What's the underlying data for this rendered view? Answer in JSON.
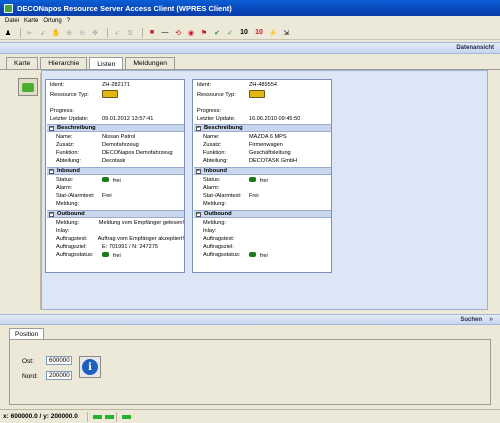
{
  "window": {
    "title": "DECONapos Resource Server Access Client (WPRES Client)"
  },
  "menu": [
    "Datei",
    "Karte",
    "Ortung",
    "?"
  ],
  "toolbar": {
    "text_buttons": [
      "10",
      "10"
    ]
  },
  "top_band": {
    "label": "Datenansicht"
  },
  "tabs": [
    "Karte",
    "Hierarchie",
    "Listen",
    "Meldungen"
  ],
  "active_tab": "Listen",
  "cards": [
    {
      "ident": "ZH-282171",
      "ressource_typ": "",
      "progress": "",
      "letzter_update": "09.01.2012 13:57:41",
      "beschreibung": {
        "name": "Nissan Patrol",
        "zusatz": "Demofahrzeug",
        "funktion": "DECONapos Demofahrzeug",
        "abteilung": "Decotask"
      },
      "inbound": {
        "status": "frei",
        "alarm": "",
        "stat_alarmtext": "Frei",
        "meldung": ""
      },
      "outbound": {
        "meldung": "Meldung vom Empfänger gelesen!",
        "inlay": "",
        "auftragstext": "Auftrag vom Empfänger akzeptiert!",
        "auftragsziel": "E: 701991 / N: 247275",
        "auftragsstatus": "frei"
      }
    },
    {
      "ident": "ZH-489554",
      "ressource_typ": "",
      "progress": "",
      "letzter_update": "16.06.2010 09:45:50",
      "beschreibung": {
        "name": "MAZDA 6 MPS",
        "zusatz": "Firmenwagen",
        "funktion": "Geschäftsleitung",
        "abteilung": "DECOTASK GmbH"
      },
      "inbound": {
        "status": "frei",
        "alarm": "",
        "stat_alarmtext": "Frei",
        "meldung": ""
      },
      "outbound": {
        "meldung": "",
        "inlay": "",
        "auftragstext": "",
        "auftragsziel": "",
        "auftragsstatus": "frei"
      }
    }
  ],
  "labels": {
    "ident": "Ident:",
    "ressource_typ": "Ressource Typ:",
    "progress": "Progress:",
    "letzter_update": "Letzter Update:",
    "beschreibung": "Beschreibung",
    "name": "Name:",
    "zusatz": "Zusatz:",
    "funktion": "Funktion:",
    "abteilung": "Abteilung:",
    "inbound": "Inbound",
    "status": "Status:",
    "alarm": "Alarm:",
    "stat_alarmtext": "Stat-/Alarmtext:",
    "meldung": "Meldung:",
    "outbound": "Outbound",
    "inlay": "Inlay:",
    "auftragstext": "Auftragstext:",
    "auftragsziel": "Auftragsziel:",
    "auftragsstatus": "Auftragsstatus:"
  },
  "bottom_band": {
    "label": "Suchen",
    "chevron": "»"
  },
  "position": {
    "tab": "Position",
    "ost_label": "Ost:",
    "ost_value": "600000",
    "nord_label": "Nord:",
    "nord_value": "200000"
  },
  "statusbar": {
    "coords": "x: 600000.0 / y: 200000.0"
  },
  "colors": {
    "title_bar": "#0a52c8",
    "band": "#c6d4ec",
    "section": "#c8d6ee",
    "indicator": "#27b32c",
    "truck": "#e3b615"
  }
}
